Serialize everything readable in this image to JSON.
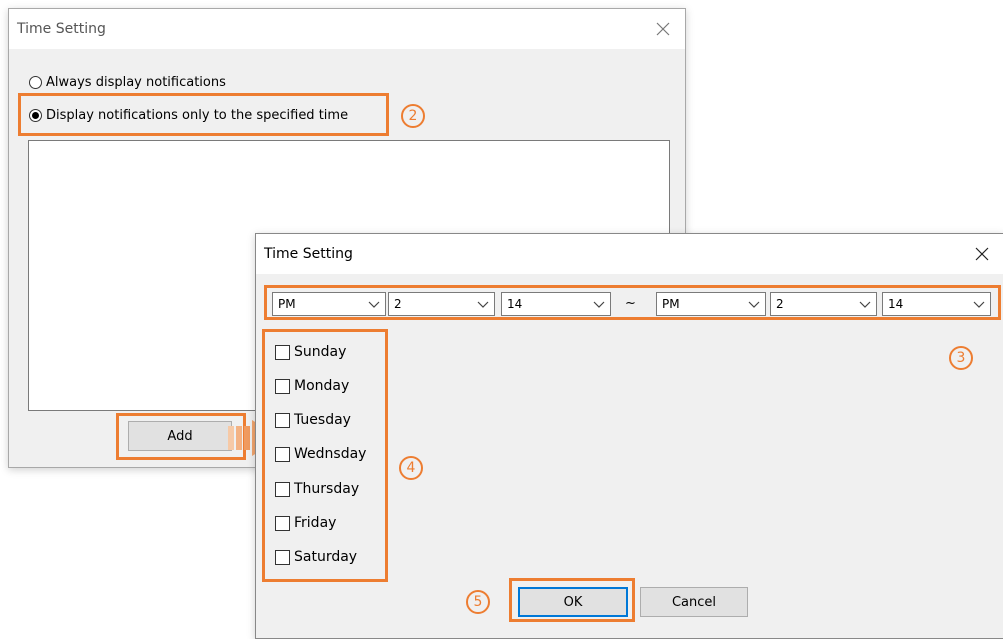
{
  "parent_dialog": {
    "title": "Time Setting",
    "radio_always": "Always display notifications",
    "radio_specified": "Display notifications only to the specified time",
    "add_button": "Add"
  },
  "child_dialog": {
    "title": "Time Setting",
    "start": {
      "ampm": "PM",
      "hour": "2",
      "minute": "14"
    },
    "separator": "~",
    "end": {
      "ampm": "PM",
      "hour": "2",
      "minute": "14"
    },
    "days": [
      "Sunday",
      "Monday",
      "Tuesday",
      "Wednsday",
      "Thursday",
      "Friday",
      "Saturday"
    ],
    "ok_button": "OK",
    "cancel_button": "Cancel"
  },
  "callouts": {
    "n2": "2",
    "n3": "3",
    "n4": "4",
    "n5": "5"
  },
  "icons": {
    "close": "close-icon",
    "chevron": "chevron-down-icon",
    "arrow": "right-arrow-icon"
  },
  "colors": {
    "callout": "#ed7d31",
    "focus": "#0078d7",
    "dialog_bg": "#f0f0f0"
  }
}
